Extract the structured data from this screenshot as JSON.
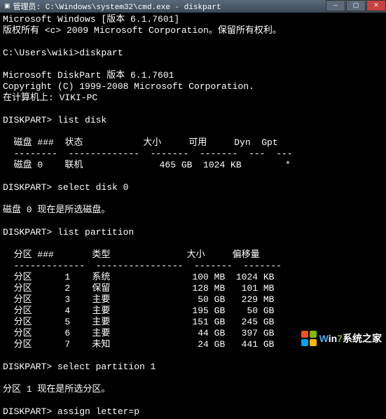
{
  "titlebar": {
    "text": "管理员: C:\\Windows\\system32\\cmd.exe - diskpart"
  },
  "lines": {
    "l1": "Microsoft Windows [版本 6.1.7601]",
    "l2": "版权所有 <c> 2009 Microsoft Corporation。保留所有权利。",
    "l3": "",
    "l4": "C:\\Users\\wiki>diskpart",
    "l5": "",
    "l6": "Microsoft DiskPart 版本 6.1.7601",
    "l7": "Copyright (C) 1999-2008 Microsoft Corporation.",
    "l8": "在计算机上: VIKI-PC",
    "l9": "",
    "l10": "DISKPART> list disk",
    "l11": "",
    "l12": "  磁盘 ###  状态           大小     可用     Dyn  Gpt",
    "l13": "  --------  -------------  -------  -------  ---  ---",
    "l14": "  磁盘 0    联机              465 GB  1024 KB        *",
    "l15": "",
    "l16": "DISKPART> select disk 0",
    "l17": "",
    "l18": "磁盘 0 现在是所选磁盘。",
    "l19": "",
    "l20": "DISKPART> list partition",
    "l21": "",
    "l22": "  分区 ###       类型              大小     偏移量",
    "l23": "  -------------  ----------------  -------  -------",
    "l24": "  分区      1    系统               100 MB  1024 KB",
    "l25": "  分区      2    保留               128 MB   101 MB",
    "l26": "  分区      3    主要                50 GB   229 MB",
    "l27": "  分区      4    主要               195 GB    50 GB",
    "l28": "  分区      5    主要               151 GB   245 GB",
    "l29": "  分区      6    主要                44 GB   397 GB",
    "l30": "  分区      7    未知                24 GB   441 GB",
    "l31": "",
    "l32": "DISKPART> select partition 1",
    "l33": "",
    "l34": "分区 1 现在是所选分区。",
    "l35": "",
    "l36": "DISKPART> assign letter=p"
  },
  "watermark": {
    "text": "Win7系统之家"
  },
  "chart_data": {
    "type": "table",
    "title": "diskpart output",
    "disks": {
      "columns": [
        "磁盘 ###",
        "状态",
        "大小",
        "可用",
        "Dyn",
        "Gpt"
      ],
      "rows": [
        {
          "id": "磁盘 0",
          "status": "联机",
          "size": "465 GB",
          "free": "1024 KB",
          "dyn": "",
          "gpt": "*"
        }
      ]
    },
    "partitions": {
      "columns": [
        "分区 ###",
        "类型",
        "大小",
        "偏移量"
      ],
      "rows": [
        {
          "id": 1,
          "type": "系统",
          "size": "100 MB",
          "offset": "1024 KB"
        },
        {
          "id": 2,
          "type": "保留",
          "size": "128 MB",
          "offset": "101 MB"
        },
        {
          "id": 3,
          "type": "主要",
          "size": "50 GB",
          "offset": "229 MB"
        },
        {
          "id": 4,
          "type": "主要",
          "size": "195 GB",
          "offset": "50 GB"
        },
        {
          "id": 5,
          "type": "主要",
          "size": "151 GB",
          "offset": "245 GB"
        },
        {
          "id": 6,
          "type": "主要",
          "size": "44 GB",
          "offset": "397 GB"
        },
        {
          "id": 7,
          "type": "未知",
          "size": "24 GB",
          "offset": "441 GB"
        }
      ]
    },
    "commands": [
      "list disk",
      "select disk 0",
      "list partition",
      "select partition 1",
      "assign letter=p"
    ]
  }
}
